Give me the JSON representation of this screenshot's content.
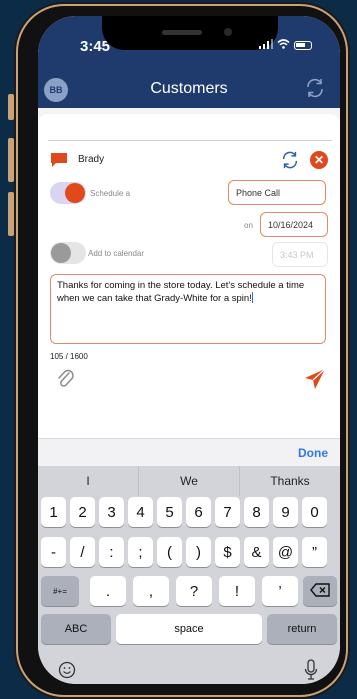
{
  "status": {
    "time": "3:45"
  },
  "nav": {
    "avatar": "BB",
    "title": "Customers"
  },
  "contact": {
    "name": "Brady"
  },
  "schedule": {
    "label": "Schedule a",
    "type_value": "Phone Call",
    "on_label": "on",
    "date_value": "10/16/2024"
  },
  "calendar": {
    "label": "Add to calendar",
    "time_value": "3:43 PM"
  },
  "message": {
    "text": "Thanks for coming in the store today. Let's schedule a time when we can take that Grady-White for a spin!",
    "counter": "105 / 1600"
  },
  "accessory": {
    "done_label": "Done"
  },
  "keyboard": {
    "suggestions": [
      "I",
      "We",
      "Thanks"
    ],
    "row1": [
      "1",
      "2",
      "3",
      "4",
      "5",
      "6",
      "7",
      "8",
      "9",
      "0"
    ],
    "row2": [
      "-",
      "/",
      ":",
      ";",
      "(",
      ")",
      "$",
      "&",
      "@",
      "”"
    ],
    "row3_left": "#+=",
    "row3": [
      ".",
      ",",
      "?",
      "!",
      "’"
    ],
    "abc": "ABC",
    "space": "space",
    "return": "return"
  },
  "colors": {
    "nav_bg": "#1f3b6e",
    "accent": "#e04a1b",
    "link": "#2f78ea"
  }
}
